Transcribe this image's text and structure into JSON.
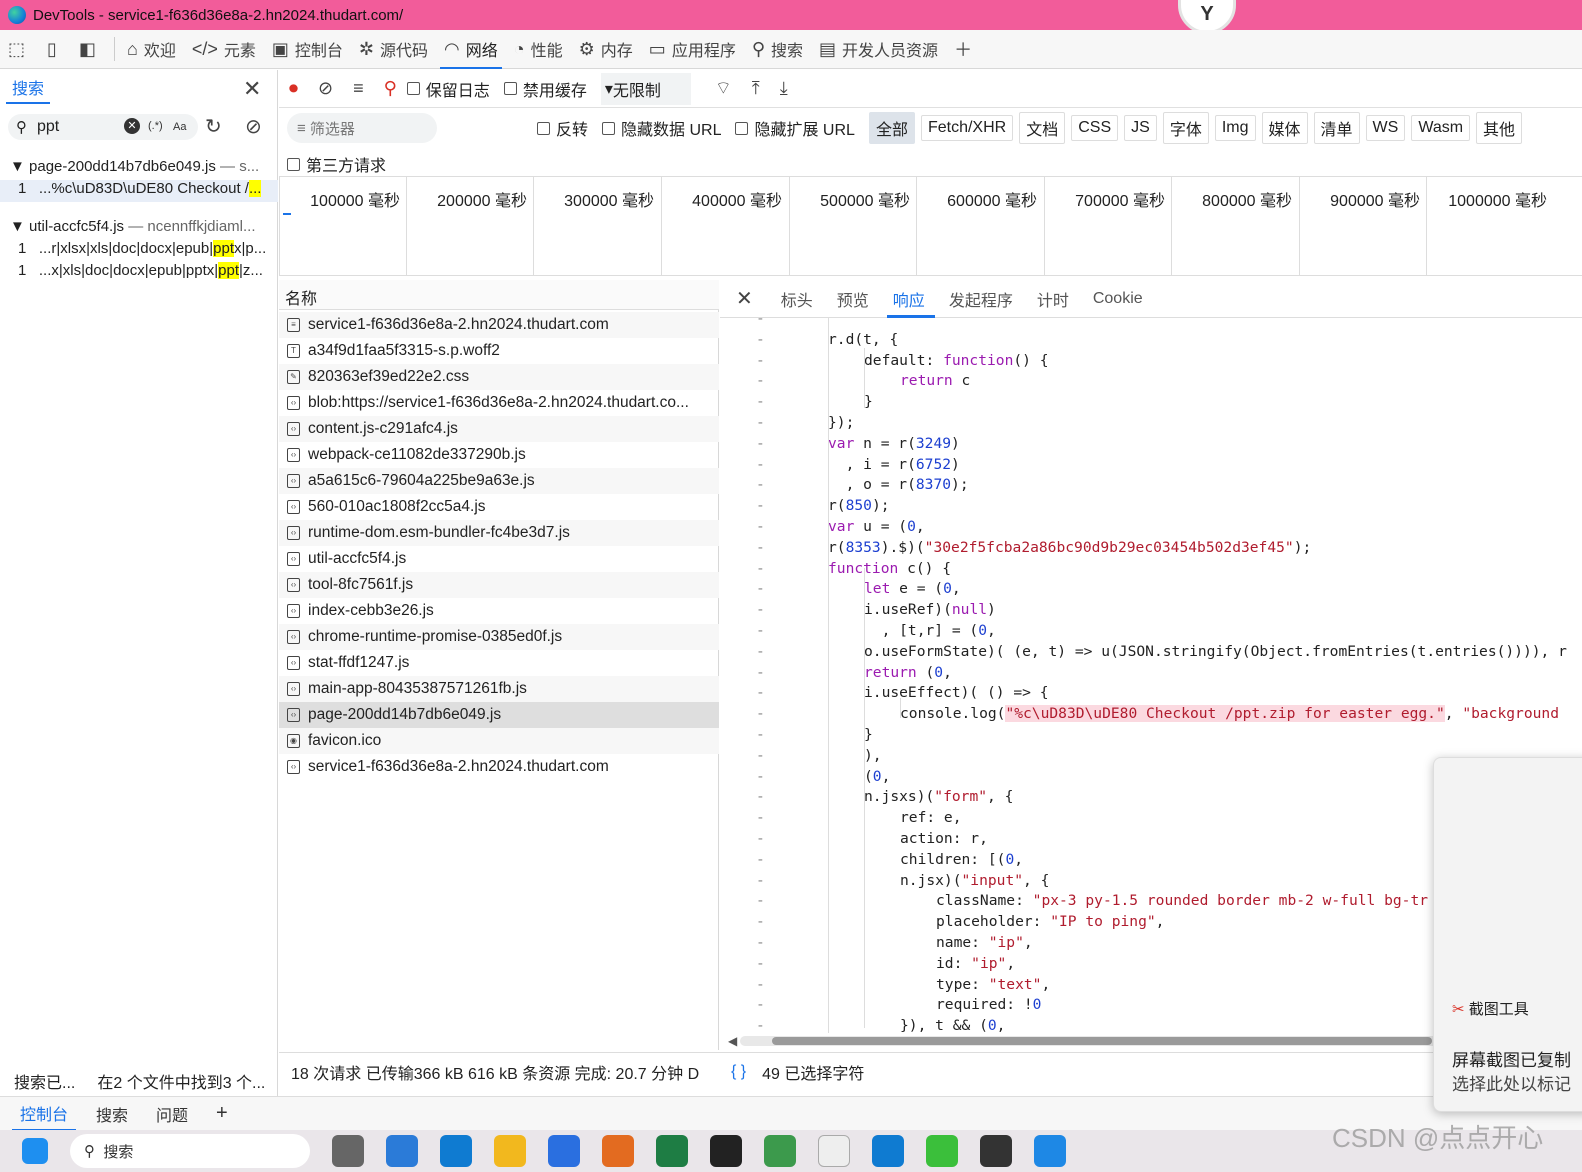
{
  "window": {
    "title": "DevTools - service1-f636d36e8a-2.hn2024.thudart.com/",
    "badge": "Y"
  },
  "main_tabs": [
    {
      "label": "欢迎",
      "icon": "home-icon"
    },
    {
      "label": "元素",
      "icon": "code-icon"
    },
    {
      "label": "控制台",
      "icon": "console-icon"
    },
    {
      "label": "源代码",
      "icon": "bug-icon"
    },
    {
      "label": "网络",
      "icon": "wifi-icon"
    },
    {
      "label": "性能",
      "icon": "gauge-icon"
    },
    {
      "label": "内存",
      "icon": "gear-icon"
    },
    {
      "label": "应用程序",
      "icon": "app-icon"
    },
    {
      "label": "搜索",
      "icon": "search-icon"
    },
    {
      "label": "开发人员资源",
      "icon": "docs-icon"
    }
  ],
  "search_panel": {
    "tab_label": "搜索",
    "query": "ppt",
    "case_label": "Aa",
    "regex_label": "(.*)",
    "results": [
      {
        "file": "page-200dd14b7db6e049.js",
        "source": "— s...",
        "lines": [
          {
            "num": "1",
            "pre": "...%c\\uD83D\\uDE80 Checkout /",
            "hit": "...",
            "post": ""
          }
        ]
      },
      {
        "file": "util-accfc5f4.js",
        "source": "— ncennffkjdiaml...",
        "lines": [
          {
            "num": "1",
            "pre": "...r|xlsx|xls|doc|docx|epub|",
            "hit": "ppt",
            "post": "x|p..."
          },
          {
            "num": "1",
            "pre": "...x|xls|doc|docx|epub|pptx|",
            "hit": "ppt",
            "post": "|z..."
          }
        ]
      }
    ],
    "status_left": "搜索已...",
    "status_right": "在2 个文件中找到3 个..."
  },
  "network": {
    "preserve_log": "保留日志",
    "disable_cache": "禁用缓存",
    "throttle": "无限制",
    "filter_placeholder": "筛选器",
    "invert": "反转",
    "hide_data_urls": "隐藏数据 URL",
    "hide_ext_urls": "隐藏扩展 URL",
    "types": [
      "全部",
      "Fetch/XHR",
      "文档",
      "CSS",
      "JS",
      "字体",
      "Img",
      "媒体",
      "清单",
      "WS",
      "Wasm",
      "其他"
    ],
    "third_party": "第三方请求",
    "ticks": [
      "100000 毫秒",
      "200000 毫秒",
      "300000 毫秒",
      "400000 毫秒",
      "500000 毫秒",
      "600000 毫秒",
      "700000 毫秒",
      "800000 毫秒",
      "900000 毫秒",
      "1000000 毫秒"
    ],
    "name_header": "名称",
    "requests": [
      {
        "name": "service1-f636d36e8a-2.hn2024.thudart.com",
        "icon": "document-icon"
      },
      {
        "name": "a34f9d1faa5f3315-s.p.woff2",
        "icon": "font-icon"
      },
      {
        "name": "820363ef39ed22e2.css",
        "icon": "stylesheet-icon"
      },
      {
        "name": "blob:https://service1-f636d36e8a-2.hn2024.thudart.co...",
        "icon": "script-icon"
      },
      {
        "name": "content.js-c291afc4.js",
        "icon": "script-icon"
      },
      {
        "name": "webpack-ce11082de337290b.js",
        "icon": "script-icon"
      },
      {
        "name": "a5a615c6-79604a225be9a63e.js",
        "icon": "script-icon"
      },
      {
        "name": "560-010ac1808f2cc5a4.js",
        "icon": "script-icon"
      },
      {
        "name": "runtime-dom.esm-bundler-fc4be3d7.js",
        "icon": "script-icon"
      },
      {
        "name": "util-accfc5f4.js",
        "icon": "script-icon"
      },
      {
        "name": "tool-8fc7561f.js",
        "icon": "script-icon"
      },
      {
        "name": "index-cebb3e26.js",
        "icon": "script-icon"
      },
      {
        "name": "chrome-runtime-promise-0385ed0f.js",
        "icon": "script-icon"
      },
      {
        "name": "stat-ffdf1247.js",
        "icon": "script-icon"
      },
      {
        "name": "main-app-80435387571261fb.js",
        "icon": "script-icon"
      },
      {
        "name": "page-200dd14b7db6e049.js",
        "icon": "script-icon"
      },
      {
        "name": "favicon.ico",
        "icon": "image-icon"
      },
      {
        "name": "service1-f636d36e8a-2.hn2024.thudart.com",
        "icon": "script-icon"
      }
    ],
    "status": "18 次请求  已传输366 kB  616 kB 条资源  完成: 20.7 分钟  D"
  },
  "detail": {
    "tabs": [
      "标头",
      "预览",
      "响应",
      "发起程序",
      "计时",
      "Cookie"
    ],
    "active_tab": "响应",
    "footer_braces": "{ }",
    "footer_text": "49 已选择字符"
  },
  "drawer": {
    "tabs": [
      "控制台",
      "搜索",
      "问题"
    ],
    "add": "+"
  },
  "toast": {
    "app": "截图工具",
    "title": "屏幕截图已复制",
    "body": "选择此处以标记"
  },
  "taskbar": {
    "search": "搜索"
  },
  "watermark": "CSDN @点点开心"
}
